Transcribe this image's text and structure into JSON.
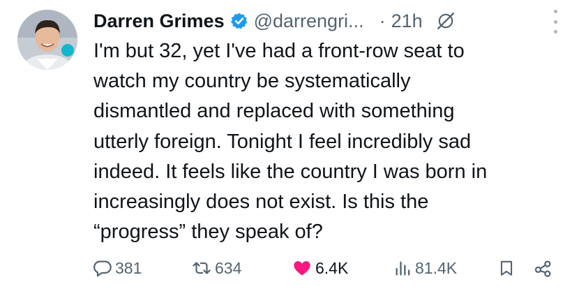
{
  "author": {
    "display_name": "Darren Grimes",
    "handle": "@darrengri...",
    "verified_color": "#1d9bf0"
  },
  "meta": {
    "separator": "·",
    "timestamp": "21h"
  },
  "icons": {
    "verified": "verified-badge-icon",
    "grok": "grok-icon",
    "more": "more-options-icon",
    "reply": "reply-icon",
    "repost": "repost-icon",
    "like": "heart-icon",
    "views": "views-icon",
    "bookmark": "bookmark-icon",
    "share": "share-icon"
  },
  "tweet": {
    "lines": [
      "I'm but 32, yet I've had a front-row seat to",
      "watch my country be systematically",
      "dismantled and replaced with something",
      "utterly foreign. Tonight I feel incredibly sad",
      "indeed. It feels like the country I was born in",
      "increasingly does not exist. Is this the",
      "“progress” they speak of?"
    ]
  },
  "actions": {
    "replies": "381",
    "reposts": "634",
    "likes": "6.4K",
    "views": "81.4K"
  },
  "colors": {
    "like": "#f91880",
    "repost": "#00ba7c",
    "muted": "#536471"
  }
}
